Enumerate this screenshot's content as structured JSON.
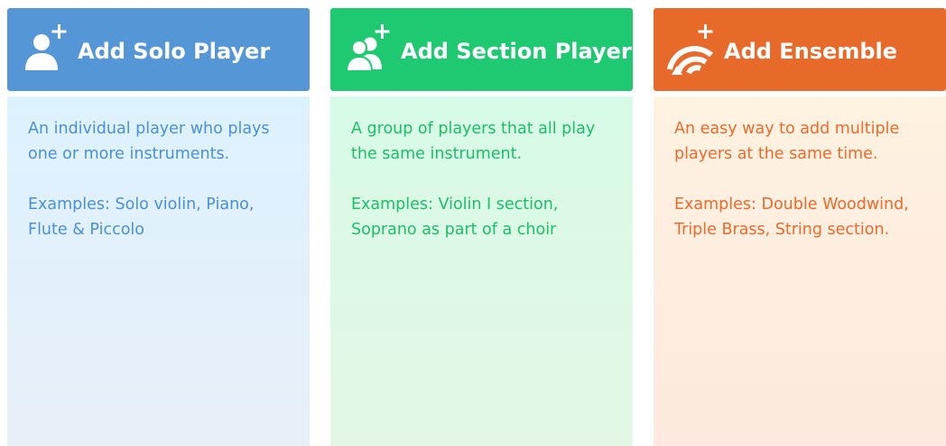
{
  "options": [
    {
      "title": "Add Solo Player",
      "description": "An individual player who plays one or more instruments.",
      "examples": "Examples: Solo violin, Piano, Flute & Piccolo",
      "icon": "add-solo-player-icon",
      "color": "#5596d6"
    },
    {
      "title": "Add Section Player",
      "description": "A group of players that all play the same instrument.",
      "examples": "Examples: Violin I section, Soprano as part of a choir",
      "icon": "add-section-player-icon",
      "color": "#1ec972"
    },
    {
      "title": "Add Ensemble",
      "description": "An easy way to add multiple players at the same time.",
      "examples": "Examples: Double Woodwind, Triple Brass, String section.",
      "icon": "add-ensemble-icon",
      "color": "#e86a2a"
    }
  ]
}
